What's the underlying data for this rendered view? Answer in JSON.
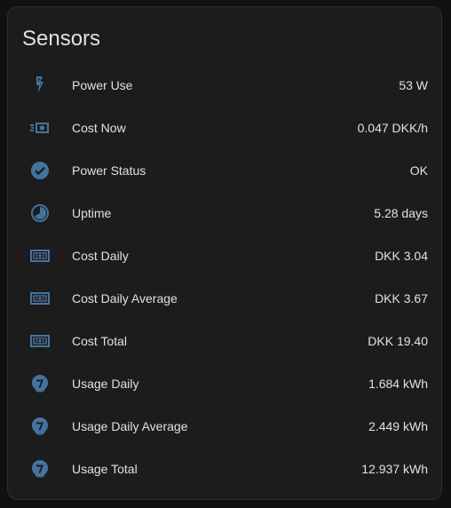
{
  "card": {
    "title": "Sensors",
    "icon_color": "#44739e",
    "rows": [
      {
        "label": "Power Use",
        "value": "53 W",
        "icon": "flash-icon"
      },
      {
        "label": "Cost Now",
        "value": "0.047 DKK/h",
        "icon": "cash-fast-icon"
      },
      {
        "label": "Power Status",
        "value": "OK",
        "icon": "check-circle-icon"
      },
      {
        "label": "Uptime",
        "value": "5.28 days",
        "icon": "clock-pie-icon"
      },
      {
        "label": "Cost Daily",
        "value": "DKK 3.04",
        "icon": "cash-icon"
      },
      {
        "label": "Cost Daily Average",
        "value": "DKK 3.67",
        "icon": "cash-icon"
      },
      {
        "label": "Cost Total",
        "value": "DKK 19.40",
        "icon": "cash-icon"
      },
      {
        "label": "Usage Daily",
        "value": "1.684 kWh",
        "icon": "meter-icon"
      },
      {
        "label": "Usage Daily Average",
        "value": "2.449 kWh",
        "icon": "meter-icon"
      },
      {
        "label": "Usage Total",
        "value": "12.937 kWh",
        "icon": "meter-icon"
      }
    ]
  }
}
